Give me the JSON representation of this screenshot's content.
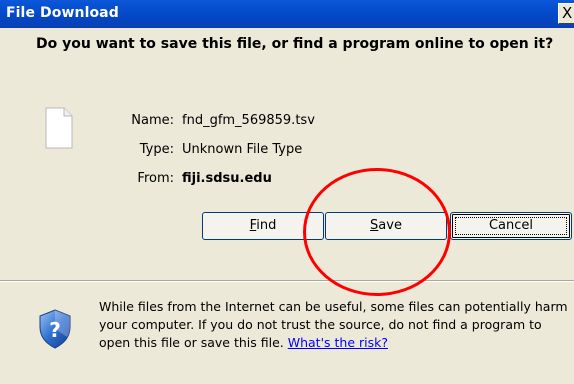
{
  "dialog": {
    "title": "File Download",
    "close_glyph": "X",
    "question": "Do you want to save this file, or find a program online to open it?",
    "file_icon": "blank-file-icon",
    "info": {
      "name_label": "Name:",
      "name_value": "fnd_gfm_569859.tsv",
      "type_label": "Type:",
      "type_value": "Unknown File Type",
      "from_label": "From:",
      "from_value": "fiji.sdsu.edu"
    },
    "buttons": {
      "find": "Find",
      "save": "Save",
      "cancel": "Cancel"
    },
    "warning": {
      "icon": "shield-question-icon",
      "text": "While files from the Internet can be useful, some files can potentially harm your computer. If you do not trust the source, do not find a program to open this file or save this file.",
      "link": "What's the risk?"
    },
    "colors": {
      "titlebar": "#0348c7",
      "dialog_bg": "#ece9d8",
      "annotation": "#ff0000",
      "link": "#0000ff"
    }
  }
}
